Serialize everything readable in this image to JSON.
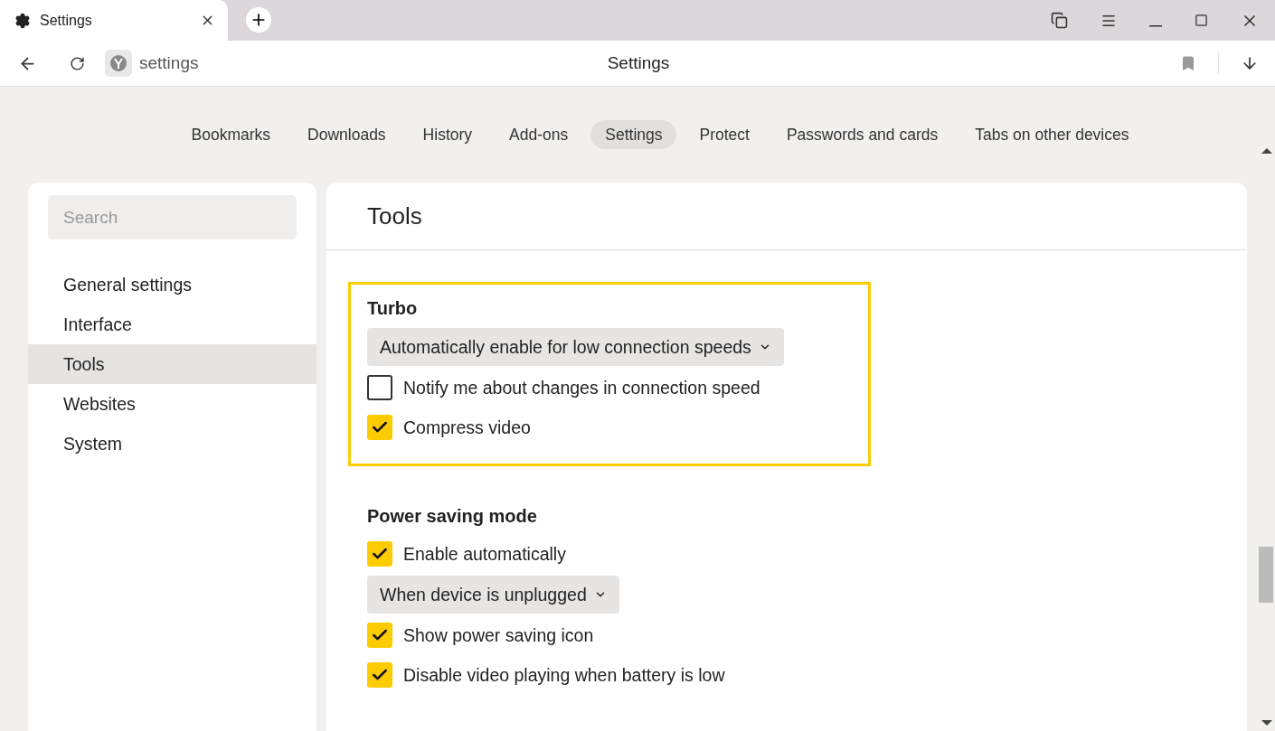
{
  "browser_tab": {
    "title": "Settings"
  },
  "address_bar": {
    "url": "settings",
    "page_title": "Settings"
  },
  "nav_tabs": [
    {
      "label": "Bookmarks",
      "selected": false
    },
    {
      "label": "Downloads",
      "selected": false
    },
    {
      "label": "History",
      "selected": false
    },
    {
      "label": "Add-ons",
      "selected": false
    },
    {
      "label": "Settings",
      "selected": true
    },
    {
      "label": "Protect",
      "selected": false
    },
    {
      "label": "Passwords and cards",
      "selected": false
    },
    {
      "label": "Tabs on other devices",
      "selected": false
    }
  ],
  "sidebar": {
    "search": {
      "placeholder": "Search"
    },
    "items": [
      {
        "label": "General settings",
        "selected": false
      },
      {
        "label": "Interface",
        "selected": false
      },
      {
        "label": "Tools",
        "selected": true
      },
      {
        "label": "Websites",
        "selected": false
      },
      {
        "label": "System",
        "selected": false
      }
    ]
  },
  "content": {
    "title": "Tools",
    "sections": [
      {
        "title": "Turbo",
        "highlighted": true,
        "controls": [
          {
            "kind": "dropdown",
            "value": "Automatically enable for low connection speeds"
          },
          {
            "kind": "checkbox",
            "label": "Notify me about changes in connection speed",
            "checked": false
          },
          {
            "kind": "checkbox",
            "label": "Compress video",
            "checked": true
          }
        ]
      },
      {
        "title": "Power saving mode",
        "highlighted": false,
        "controls": [
          {
            "kind": "checkbox",
            "label": "Enable automatically",
            "checked": true
          },
          {
            "kind": "dropdown",
            "value": "When device is unplugged"
          },
          {
            "kind": "checkbox",
            "label": "Show power saving icon",
            "checked": true
          },
          {
            "kind": "checkbox",
            "label": "Disable video playing when battery is low",
            "checked": true
          }
        ]
      }
    ]
  }
}
